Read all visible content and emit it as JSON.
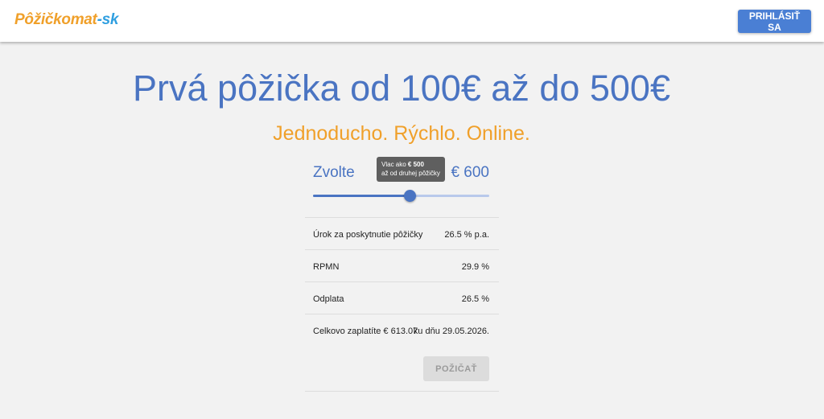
{
  "header": {
    "logo_part1": "Pôžičkomat",
    "logo_part2": "-sk",
    "login_label": "PRIHLÁSIŤ SA"
  },
  "hero": {
    "title": "Prvá pôžička od 100€ až do 500€",
    "subtitle": "Jednoducho. Rýchlo. Online."
  },
  "calculator": {
    "label": "Zvolte",
    "amount_display": "€ 600",
    "tooltip": {
      "prefix": "Vlac ako ",
      "highlight": "€ 500",
      "line2": "až od druhej pôžičky"
    },
    "slider": {
      "value_fraction": 0.55
    },
    "rows": [
      {
        "label": "Úrok za poskytnutie pôžičky",
        "value": "26.5 % p.a."
      },
      {
        "label": "RPMN",
        "value": "29.9 %"
      },
      {
        "label": "Odplata",
        "value": "26.5 %"
      },
      {
        "label": "Celkovo zaplatíte € 613.07",
        "value": "ku dňu 29.05.2026."
      }
    ],
    "submit_label": "POŽIČAŤ"
  },
  "colors": {
    "primary": "#4a74c2",
    "accent": "#f0a02a",
    "logo_blue": "#2f9fe0",
    "background": "#f2f2f2"
  }
}
